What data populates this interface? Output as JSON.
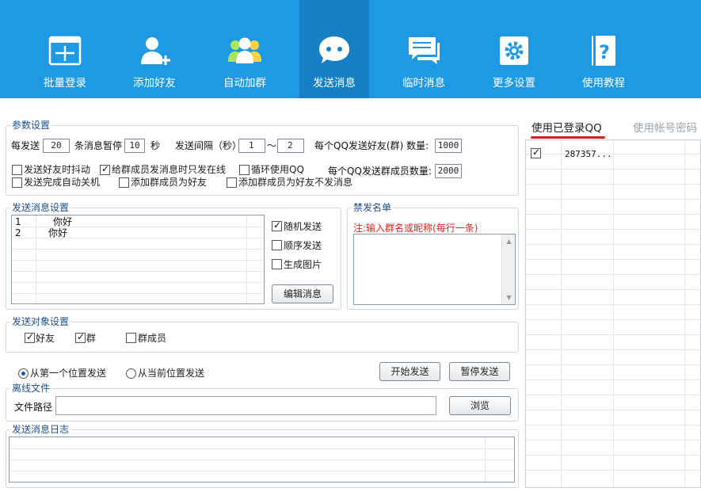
{
  "toolbar": {
    "items": [
      {
        "label": "批量登录",
        "icon": "batch-login-icon"
      },
      {
        "label": "添加好友",
        "icon": "add-friend-icon"
      },
      {
        "label": "自动加群",
        "icon": "auto-join-group-icon"
      },
      {
        "label": "发送消息",
        "icon": "send-message-icon"
      },
      {
        "label": "临时消息",
        "icon": "temp-message-icon"
      },
      {
        "label": "更多设置",
        "icon": "more-settings-icon"
      },
      {
        "label": "使用教程",
        "icon": "tutorial-icon"
      }
    ],
    "active_index": 3,
    "colors": {
      "bg": "#1d9ae3",
      "active_bg": "#1580c6"
    }
  },
  "params": {
    "title": "参数设置",
    "every_send_label": "每发送",
    "every_send_value": "20",
    "pause_label": "条消息暂停",
    "pause_value": "10",
    "seconds_label": "秒",
    "interval_label": "发送间隔（秒）",
    "interval_from": "1",
    "interval_sep": "～",
    "interval_to": "2",
    "friend_count_label": "每个QQ发送好友(群) 数量:",
    "friend_count_value": "1000",
    "group_member_count_label": "每个QQ发送群成员数量:",
    "group_member_count_value": "2000",
    "options": [
      {
        "label": "发送好友时抖动",
        "checked": false
      },
      {
        "label": "给群成员发消息时只发在线",
        "checked": true
      },
      {
        "label": "循环使用QQ",
        "checked": false
      },
      {
        "label": "发送完成自动关机",
        "checked": false
      },
      {
        "label": "添加群成员为好友",
        "checked": false
      },
      {
        "label": "添加群成员为好友不发消息",
        "checked": false
      }
    ]
  },
  "message_settings": {
    "title": "发送消息设置",
    "messages": [
      {
        "index": "1",
        "text": "你好"
      },
      {
        "index": "2",
        "text": "你好"
      }
    ],
    "options": [
      {
        "label": "随机发送",
        "checked": true
      },
      {
        "label": "顺序发送",
        "checked": false
      },
      {
        "label": "生成图片",
        "checked": false
      }
    ],
    "edit_button": "编辑消息"
  },
  "blacklist": {
    "title": "禁发名单",
    "note": "注:输入群名或昵称(每行一条)"
  },
  "targets": {
    "title": "发送对象设置",
    "options": [
      {
        "label": "好友",
        "checked": true
      },
      {
        "label": "群",
        "checked": true
      },
      {
        "label": "群成员",
        "checked": false
      }
    ]
  },
  "send_position": {
    "options": [
      {
        "label": "从第一个位置发送",
        "checked": true
      },
      {
        "label": "从当前位置发送",
        "checked": false
      }
    ],
    "start_button": "开始发送",
    "pause_button": "暂停发送"
  },
  "offline_file": {
    "title": "离线文件",
    "path_label": "文件路径",
    "path_value": "",
    "browse_button": "浏览"
  },
  "log": {
    "title": "发送消息日志"
  },
  "right_panel": {
    "tabs": [
      {
        "label": "使用已登录QQ",
        "active": true
      },
      {
        "label": "使用帐号密码",
        "active": false
      }
    ],
    "accounts": [
      {
        "checked": true,
        "qq": "287357..."
      }
    ],
    "accent": "#d81e1e"
  }
}
